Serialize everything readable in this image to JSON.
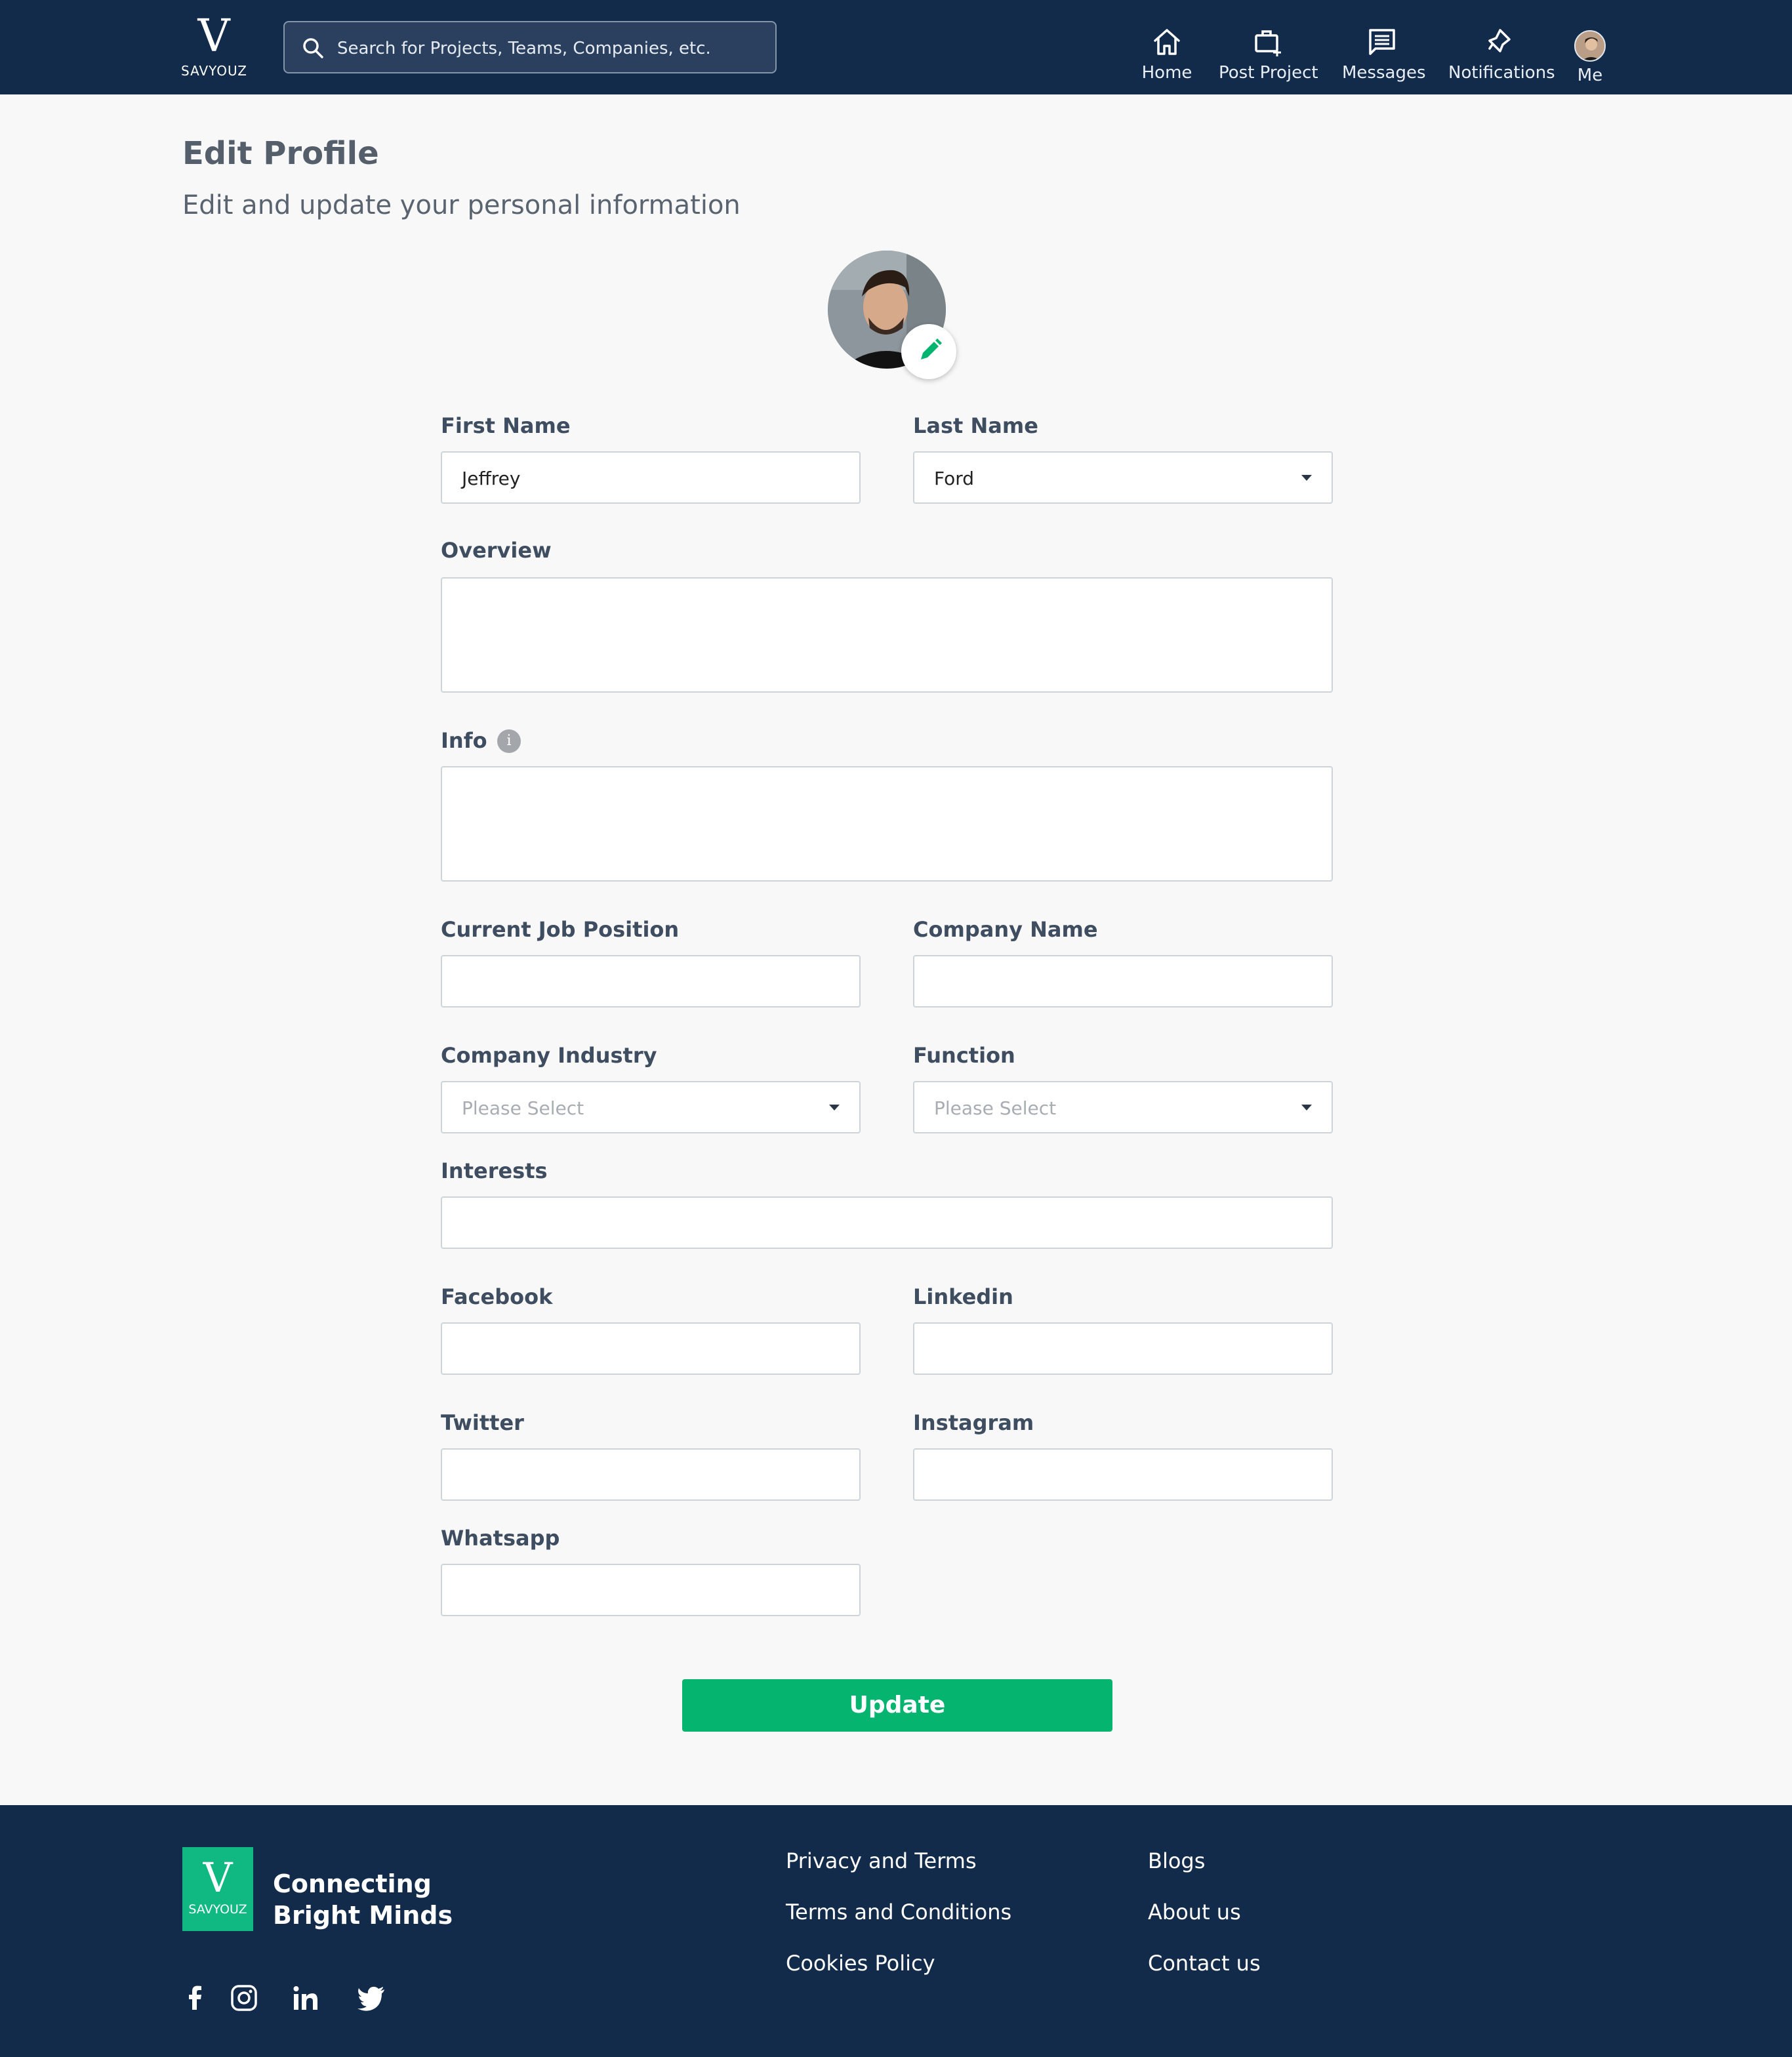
{
  "header": {
    "logo_mark": "V",
    "logo_text": "SAVYOUZ",
    "search_placeholder": "Search for Projects, Teams, Companies, etc.",
    "nav": [
      {
        "label": "Home",
        "icon": "home-icon"
      },
      {
        "label": "Post Project",
        "icon": "briefcase-plus-icon"
      },
      {
        "label": "Messages",
        "icon": "message-icon"
      },
      {
        "label": "Notifications",
        "icon": "bell-icon"
      },
      {
        "label": "Me",
        "icon": "avatar"
      }
    ]
  },
  "page": {
    "title": "Edit Profile",
    "subtitle": "Edit and update your personal information"
  },
  "form": {
    "first_name": {
      "label": "First Name",
      "value": "Jeffrey"
    },
    "last_name": {
      "label": "Last Name",
      "value": "Ford"
    },
    "overview": {
      "label": "Overview",
      "value": ""
    },
    "info": {
      "label": "Info",
      "value": ""
    },
    "current_job_position": {
      "label": "Current Job Position",
      "value": ""
    },
    "company_name": {
      "label": "Company Name",
      "value": ""
    },
    "company_industry": {
      "label": "Company Industry",
      "placeholder": "Please Select"
    },
    "function": {
      "label": "Function",
      "placeholder": "Please Select"
    },
    "interests": {
      "label": "Interests",
      "value": ""
    },
    "facebook": {
      "label": "Facebook",
      "value": ""
    },
    "linkedin": {
      "label": "Linkedin",
      "value": ""
    },
    "twitter": {
      "label": "Twitter",
      "value": ""
    },
    "instagram": {
      "label": "Instagram",
      "value": ""
    },
    "whatsapp": {
      "label": "Whatsapp",
      "value": ""
    },
    "submit_label": "Update"
  },
  "footer": {
    "logo_mark": "V",
    "logo_text": "SAVYOUZ",
    "tagline_line1": "Connecting",
    "tagline_line2": "Bright Minds",
    "social": [
      "facebook-icon",
      "instagram-icon",
      "linkedin-icon",
      "twitter-icon"
    ],
    "links_col1": [
      "Privacy and Terms",
      "Terms and Conditions",
      "Cookies Policy"
    ],
    "links_col2": [
      "Blogs",
      "About us",
      "Contact us"
    ]
  },
  "colors": {
    "header_bg": "#132b4b",
    "accent_green": "#05b46f",
    "page_bg": "#f8f8f8"
  }
}
